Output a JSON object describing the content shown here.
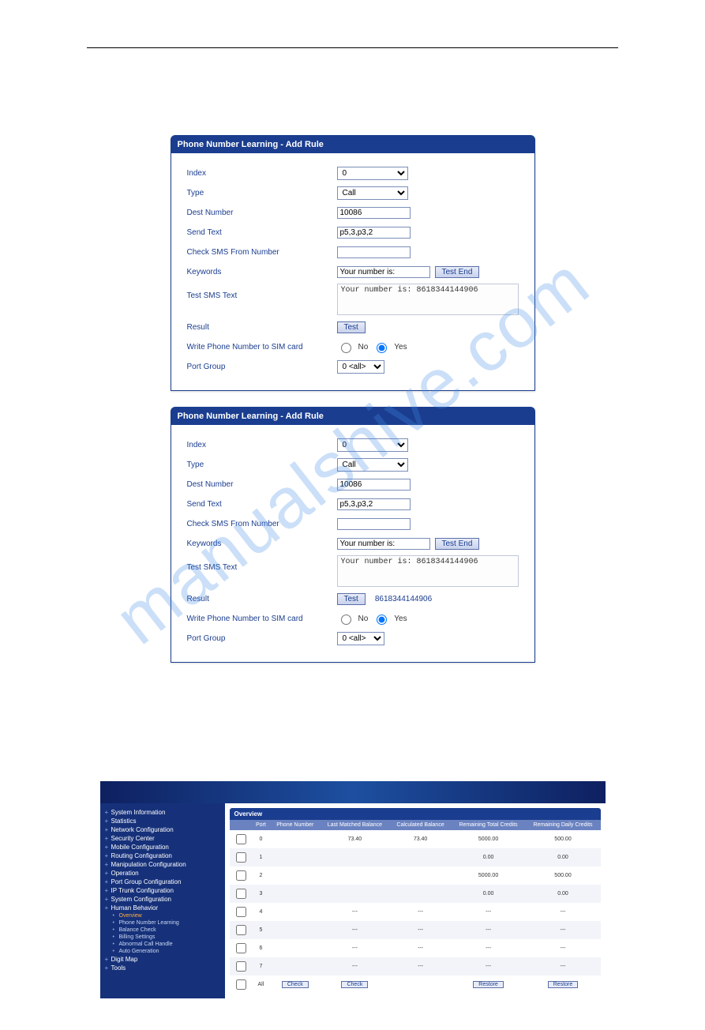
{
  "watermark": "manualshive.com",
  "panel1": {
    "title": "Phone Number Learning - Add Rule",
    "labels": {
      "index": "Index",
      "type": "Type",
      "dest": "Dest Number",
      "sendtext": "Send Text",
      "checksms": "Check SMS From Number",
      "keywords": "Keywords",
      "testtext": "Test SMS Text",
      "result": "Result",
      "writesim": "Write Phone Number to SIM card",
      "portgroup": "Port Group"
    },
    "values": {
      "index": "0",
      "type": "Call",
      "dest": "10086",
      "sendtext": "p5,3,p3,2",
      "checksms": "",
      "keywords": "Your number is:",
      "testtext": "Your number is: 8618344144906",
      "portgroup": "0 <all>"
    },
    "buttons": {
      "testend": "Test End",
      "test": "Test"
    },
    "radio": {
      "no": "No",
      "yes": "Yes"
    },
    "resultExtra": ""
  },
  "panel2": {
    "title": "Phone Number Learning - Add Rule",
    "labels": {
      "index": "Index",
      "type": "Type",
      "dest": "Dest Number",
      "sendtext": "Send Text",
      "checksms": "Check SMS From Number",
      "keywords": "Keywords",
      "testtext": "Test SMS Text",
      "result": "Result",
      "writesim": "Write Phone Number to SIM card",
      "portgroup": "Port Group"
    },
    "values": {
      "index": "0",
      "type": "Call",
      "dest": "10086",
      "sendtext": "p5,3,p3,2",
      "checksms": "",
      "keywords": "Your number is:",
      "testtext": "Your number is: 8618344144906",
      "portgroup": "0 <all>"
    },
    "buttons": {
      "testend": "Test End",
      "test": "Test"
    },
    "radio": {
      "no": "No",
      "yes": "Yes"
    },
    "resultExtra": "8618344144906"
  },
  "sidebar": {
    "items": [
      "System Information",
      "Statistics",
      "Network Configuration",
      "Security Center",
      "Mobile Configuration",
      "Routing Configuration",
      "Manipulation Configuration",
      "Operation",
      "Port Group Configuration",
      "IP Trunk Configuration",
      "System Configuration",
      "Human Behavior"
    ],
    "subitems": [
      "Overview",
      "Phone Number Learning",
      "Balance Check",
      "Billing Settings",
      "Abnormal Call Handle",
      "Auto Generation"
    ],
    "tail": [
      "Digit Map",
      "Tools"
    ]
  },
  "overview": {
    "title": "Overview",
    "columns": [
      "",
      "Port",
      "Phone Number",
      "Last Matched Balance",
      "Calculated Balance",
      "Remaining Total Credits",
      "Remaining Daily Credits"
    ],
    "rows": [
      {
        "port": "0",
        "phone": "",
        "lmb": "73.40",
        "cb": "73.40",
        "rtc": "5000.00",
        "rdc": "500.00"
      },
      {
        "port": "1",
        "phone": "",
        "lmb": "",
        "cb": "",
        "rtc": "0.00",
        "rdc": "0.00"
      },
      {
        "port": "2",
        "phone": "",
        "lmb": "",
        "cb": "",
        "rtc": "5000.00",
        "rdc": "500.00"
      },
      {
        "port": "3",
        "phone": "",
        "lmb": "",
        "cb": "",
        "rtc": "0.00",
        "rdc": "0.00"
      },
      {
        "port": "4",
        "phone": "",
        "lmb": "---",
        "cb": "---",
        "rtc": "---",
        "rdc": "---"
      },
      {
        "port": "5",
        "phone": "",
        "lmb": "---",
        "cb": "---",
        "rtc": "---",
        "rdc": "---"
      },
      {
        "port": "6",
        "phone": "",
        "lmb": "---",
        "cb": "---",
        "rtc": "---",
        "rdc": "---"
      },
      {
        "port": "7",
        "phone": "",
        "lmb": "---",
        "cb": "---",
        "rtc": "---",
        "rdc": "---"
      }
    ],
    "footer": {
      "all": "All",
      "check": "Check",
      "restore": "Restore"
    }
  }
}
